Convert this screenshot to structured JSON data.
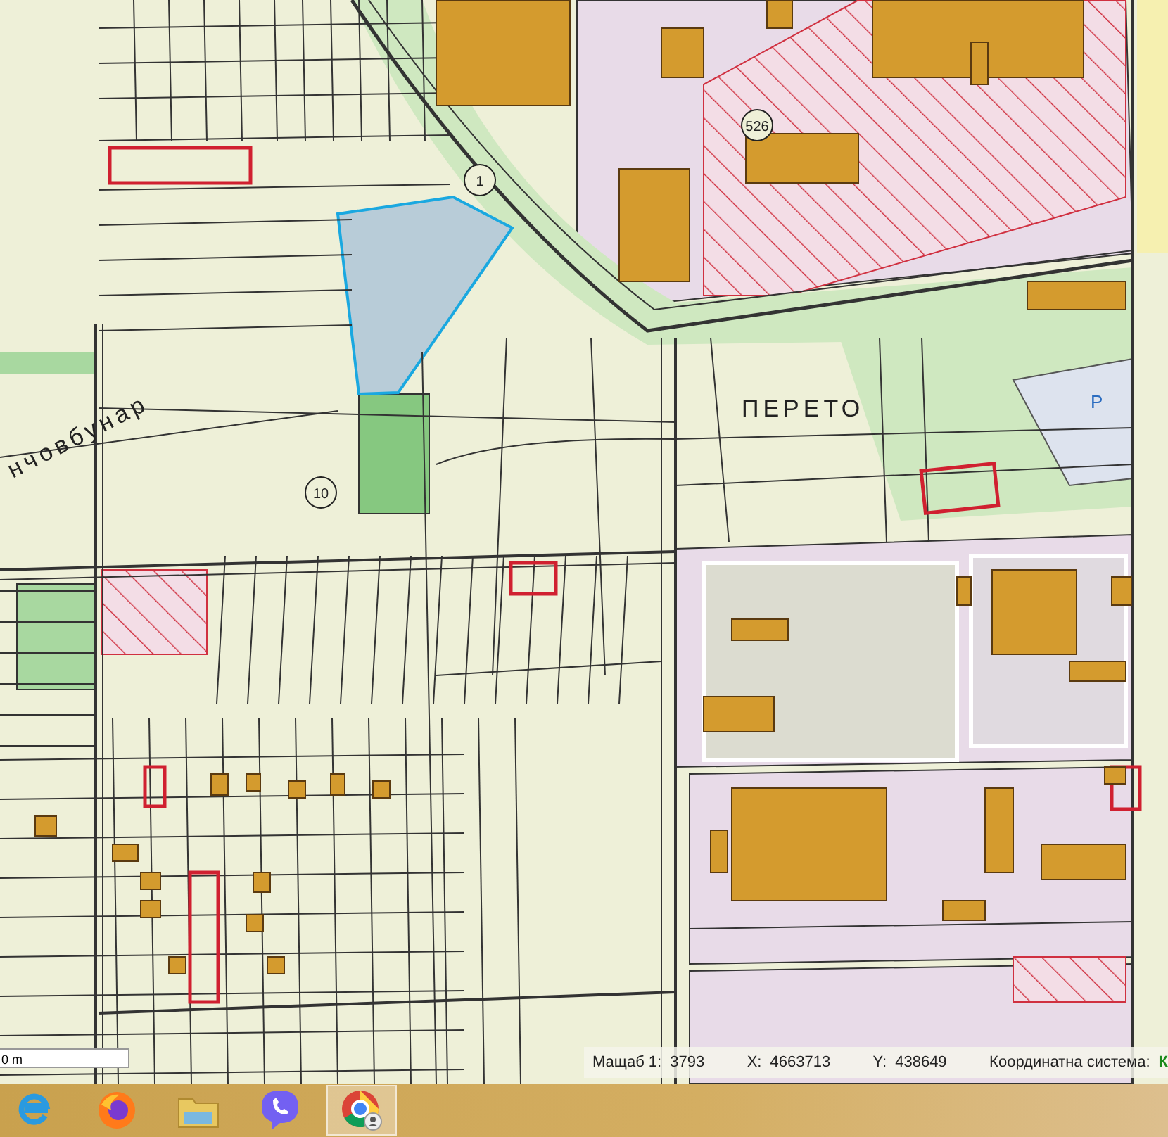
{
  "map": {
    "labels": [
      {
        "kind": "area",
        "text": "ПЕРЕТО"
      },
      {
        "kind": "street",
        "text": "нчовбунар"
      },
      {
        "kind": "marker",
        "text": "1"
      },
      {
        "kind": "marker",
        "text": "10"
      },
      {
        "kind": "marker",
        "text": "526"
      },
      {
        "kind": "parking",
        "text": "P"
      }
    ],
    "scale_bar": "0 m"
  },
  "status_bar": {
    "scale_label": "Мащаб 1:",
    "scale_value": "3793",
    "x_label": "X:",
    "x_value": "4663713",
    "y_label": "Y:",
    "y_value": "438649",
    "crs_label": "Координатна система:",
    "crs_value": "К"
  },
  "taskbar": {
    "apps": [
      {
        "kind": "ie",
        "selected": false
      },
      {
        "kind": "firefox",
        "selected": false
      },
      {
        "kind": "files",
        "selected": false
      },
      {
        "kind": "viber",
        "selected": false
      },
      {
        "kind": "chrome",
        "selected": true
      }
    ]
  }
}
